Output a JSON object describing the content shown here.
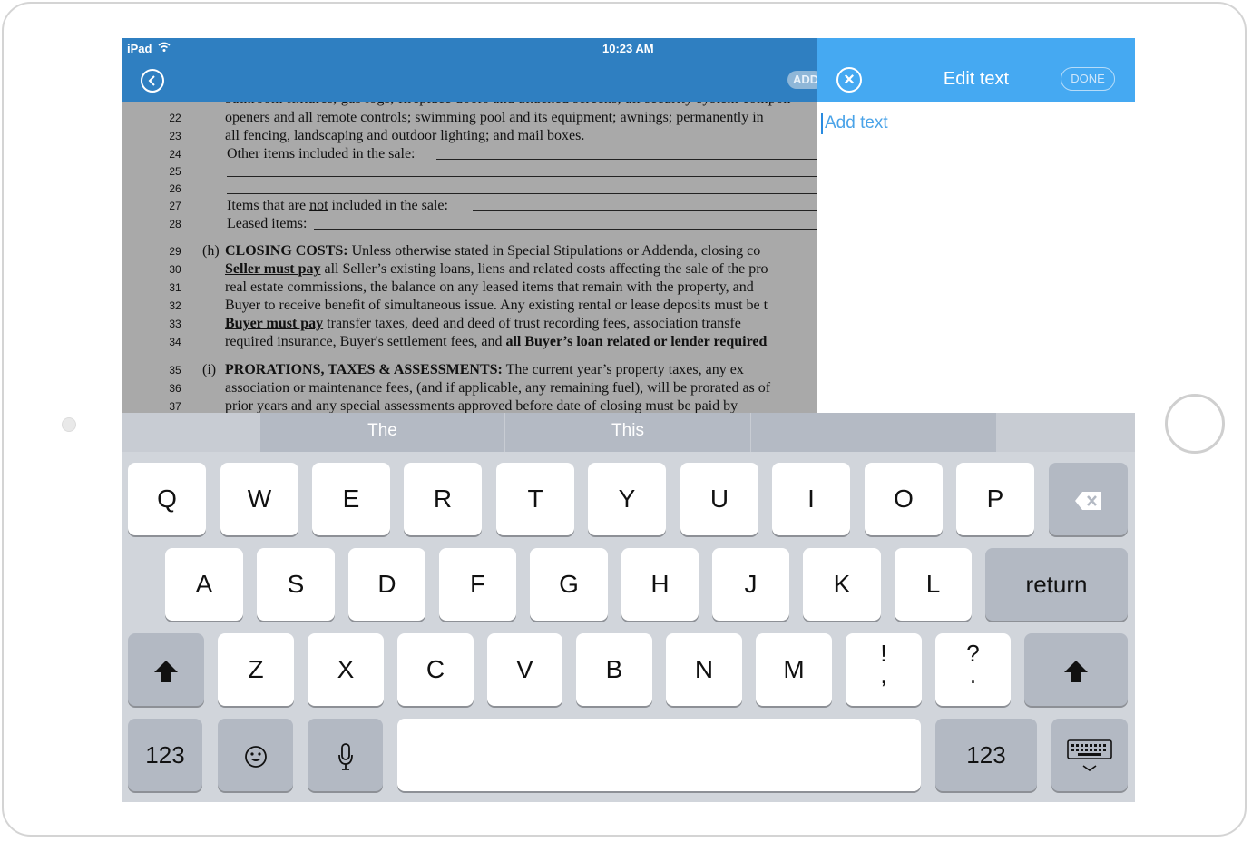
{
  "status_bar": {
    "carrier": "iPad",
    "time": "10:23 AM"
  },
  "toolbar": {
    "add_label": "ADD"
  },
  "document": {
    "line_22": {
      "num": "22",
      "text": "openers and all remote controls; swimming pool and its equipment; awnings; permanently in"
    },
    "line_23": {
      "num": "23",
      "text": "all fencing, landscaping and outdoor lighting; and mail boxes."
    },
    "line_24": {
      "num": "24",
      "text": "Other items included in the sale:"
    },
    "line_25": {
      "num": "25"
    },
    "line_26": {
      "num": "26"
    },
    "line_27": {
      "num": "27",
      "pre": "Items that are ",
      "underlined": "not",
      "post": " included in the sale:"
    },
    "line_28": {
      "num": "28",
      "text": "Leased items:"
    },
    "line_29": {
      "num": "29",
      "marker": "(h)",
      "bold": "CLOSING COSTS:",
      "text": " Unless otherwise stated in Special Stipulations or Addenda, closing co"
    },
    "line_30": {
      "num": "30",
      "bold": "Seller must pay",
      "text": " all Seller’s existing loans, liens and related costs affecting the sale of the pro"
    },
    "line_31": {
      "num": "31",
      "text": "real estate commissions, the balance on any leased items that remain with the property, and"
    },
    "line_32": {
      "num": "32",
      "text": "Buyer to receive benefit of simultaneous issue. Any existing rental or lease deposits must be t"
    },
    "line_33": {
      "num": "33",
      "bold": "Buyer must pay",
      "text": " transfer taxes, deed and deed of trust recording fees, association transfe"
    },
    "line_34": {
      "num": "34",
      "text": "required insurance, Buyer's settlement fees, and ",
      "bold": "all Buyer’s loan related or lender required"
    },
    "line_35": {
      "num": "35",
      "marker": "(i)",
      "bold": "PRORATIONS, TAXES & ASSESSMENTS:",
      "text": " The current year’s property taxes, any ex"
    },
    "line_36": {
      "num": "36",
      "text": "association or maintenance fees, (and if applicable, any remaining fuel), will be prorated as of"
    },
    "line_37": {
      "num": "37",
      "text": "prior years and any special assessments approved before date of closing must be paid by"
    }
  },
  "edit_panel": {
    "title": "Edit text",
    "done_label": "DONE",
    "placeholder": "Add text",
    "value": ""
  },
  "keyboard": {
    "suggestions": [
      "The",
      "This",
      ""
    ],
    "row1": [
      "Q",
      "W",
      "E",
      "R",
      "T",
      "Y",
      "U",
      "I",
      "O",
      "P"
    ],
    "row2": [
      "A",
      "S",
      "D",
      "F",
      "G",
      "H",
      "J",
      "K",
      "L"
    ],
    "return_label": "return",
    "row3": [
      "Z",
      "X",
      "C",
      "V",
      "B",
      "N",
      "M"
    ],
    "punct1": {
      "top": "!",
      "bottom": ","
    },
    "punct2": {
      "top": "?",
      "bottom": "."
    },
    "numbers_label": "123"
  },
  "icons": [
    "wifi-icon",
    "back-icon",
    "close-icon",
    "backspace-icon",
    "shift-icon",
    "emoji-icon",
    "microphone-icon",
    "dismiss-keyboard-icon"
  ]
}
